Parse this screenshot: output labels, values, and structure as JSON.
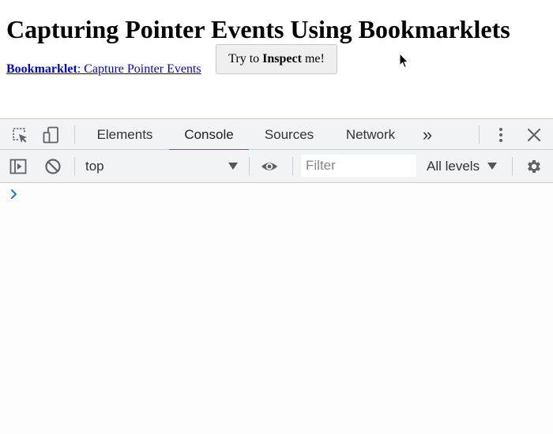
{
  "page": {
    "title": "Capturing Pointer Events Using Bookmarklets",
    "bookmarklet_bold": "Bookmarklet",
    "bookmarklet_rest": ": Capture Pointer Events",
    "inspect_button": {
      "pre": "Try to ",
      "bold": "Inspect",
      "post": " me!"
    }
  },
  "devtools": {
    "tabs": [
      {
        "label": "Elements",
        "active": false
      },
      {
        "label": "Console",
        "active": true
      },
      {
        "label": "Sources",
        "active": false
      },
      {
        "label": "Network",
        "active": false
      }
    ],
    "more_tabs_glyph": "»",
    "icons": {
      "inspect": "element-picker-icon",
      "device": "device-toolbar-icon",
      "menu": "kebab-menu-icon",
      "close": "close-icon",
      "sidebar": "show-sidebar-icon",
      "clear": "clear-console-icon",
      "eye": "live-expression-icon",
      "settings": "gear-icon",
      "prompt": "console-prompt-chevron-icon"
    },
    "console": {
      "context": "top",
      "filter_placeholder": "Filter",
      "levels": "All levels"
    },
    "accent_color": "#1a73e8"
  }
}
